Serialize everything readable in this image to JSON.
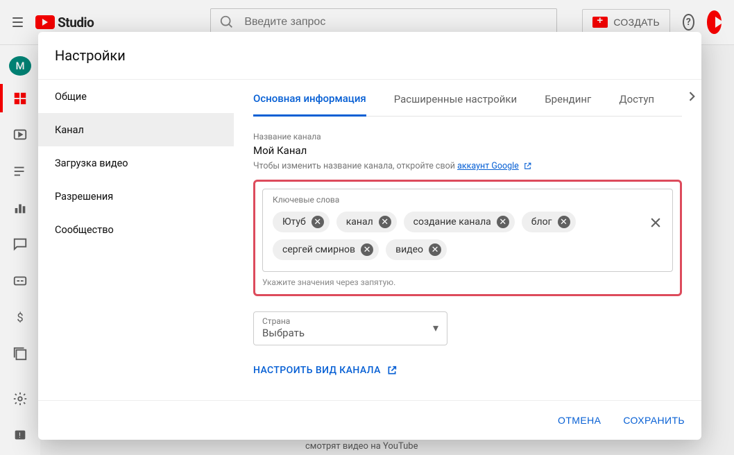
{
  "header": {
    "logo_text": "Studio",
    "search_placeholder": "Введите запрос",
    "create_label": "СОЗДАТЬ",
    "avatar_initial": "М"
  },
  "modal": {
    "title": "Настройки",
    "sidebar": [
      {
        "label": "Общие"
      },
      {
        "label": "Канал"
      },
      {
        "label": "Загрузка видео"
      },
      {
        "label": "Разрешения"
      },
      {
        "label": "Сообщество"
      }
    ],
    "tabs": [
      {
        "label": "Основная информация"
      },
      {
        "label": "Расширенные настройки"
      },
      {
        "label": "Брендинг"
      },
      {
        "label": "Доступ"
      }
    ],
    "channel_name_label": "Название канала",
    "channel_name": "Мой Канал",
    "channel_helper_prefix": "Чтобы изменить название канала, откройте свой ",
    "channel_helper_link": "аккаунт Google",
    "keywords_label": "Ключевые слова",
    "keywords": [
      "Ютуб",
      "канал",
      "создание канала",
      "блог",
      "сергей смирнов",
      "видео"
    ],
    "keywords_hint": "Укажите значения через запятую.",
    "country_label": "Страна",
    "country_value": "Выбрать",
    "channel_link_label": "НАСТРОИТЬ ВИД КАНАЛА",
    "footer_cancel": "ОТМЕНА",
    "footer_save": "СОХРАНИТЬ"
  },
  "background": {
    "bottom_text": "смотрят видео на YouTube"
  }
}
